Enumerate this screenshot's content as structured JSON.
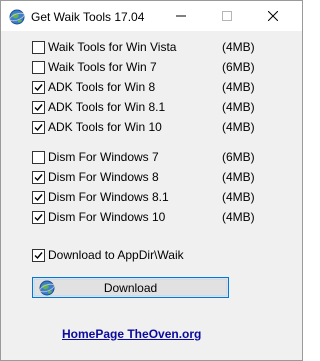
{
  "window": {
    "title": "Get Waik Tools 17.04"
  },
  "icons": {
    "app": "globe-icon",
    "minimize": "minimize-icon",
    "maximize": "maximize-icon",
    "close": "close-icon",
    "download": "globe-icon"
  },
  "options": [
    {
      "label": "Waik Tools for Win Vista",
      "size": "(4MB)",
      "checked": false
    },
    {
      "label": "Waik Tools for Win 7",
      "size": "(6MB)",
      "checked": false
    },
    {
      "label": "ADK  Tools for Win 8",
      "size": "(4MB)",
      "checked": true
    },
    {
      "label": "ADK  Tools for Win 8.1",
      "size": "(4MB)",
      "checked": true
    },
    {
      "label": "ADK  Tools for Win 10",
      "size": "(4MB)",
      "checked": true
    },
    {
      "label": "Dism For Windows 7",
      "size": "(6MB)",
      "checked": false
    },
    {
      "label": "Dism For Windows 8",
      "size": "(4MB)",
      "checked": true
    },
    {
      "label": "Dism For Windows 8.1",
      "size": "(4MB)",
      "checked": true
    },
    {
      "label": "Dism For Windows 10",
      "size": "(4MB)",
      "checked": true
    }
  ],
  "appdir": {
    "label": "Download to AppDir\\Waik",
    "checked": true
  },
  "download_button": {
    "label": "Download"
  },
  "homepage": {
    "label": "HomePage  TheOven.org"
  },
  "colors": {
    "accent": "#0078d7",
    "link": "#0a0a9e",
    "background": "#f0f0f0"
  }
}
